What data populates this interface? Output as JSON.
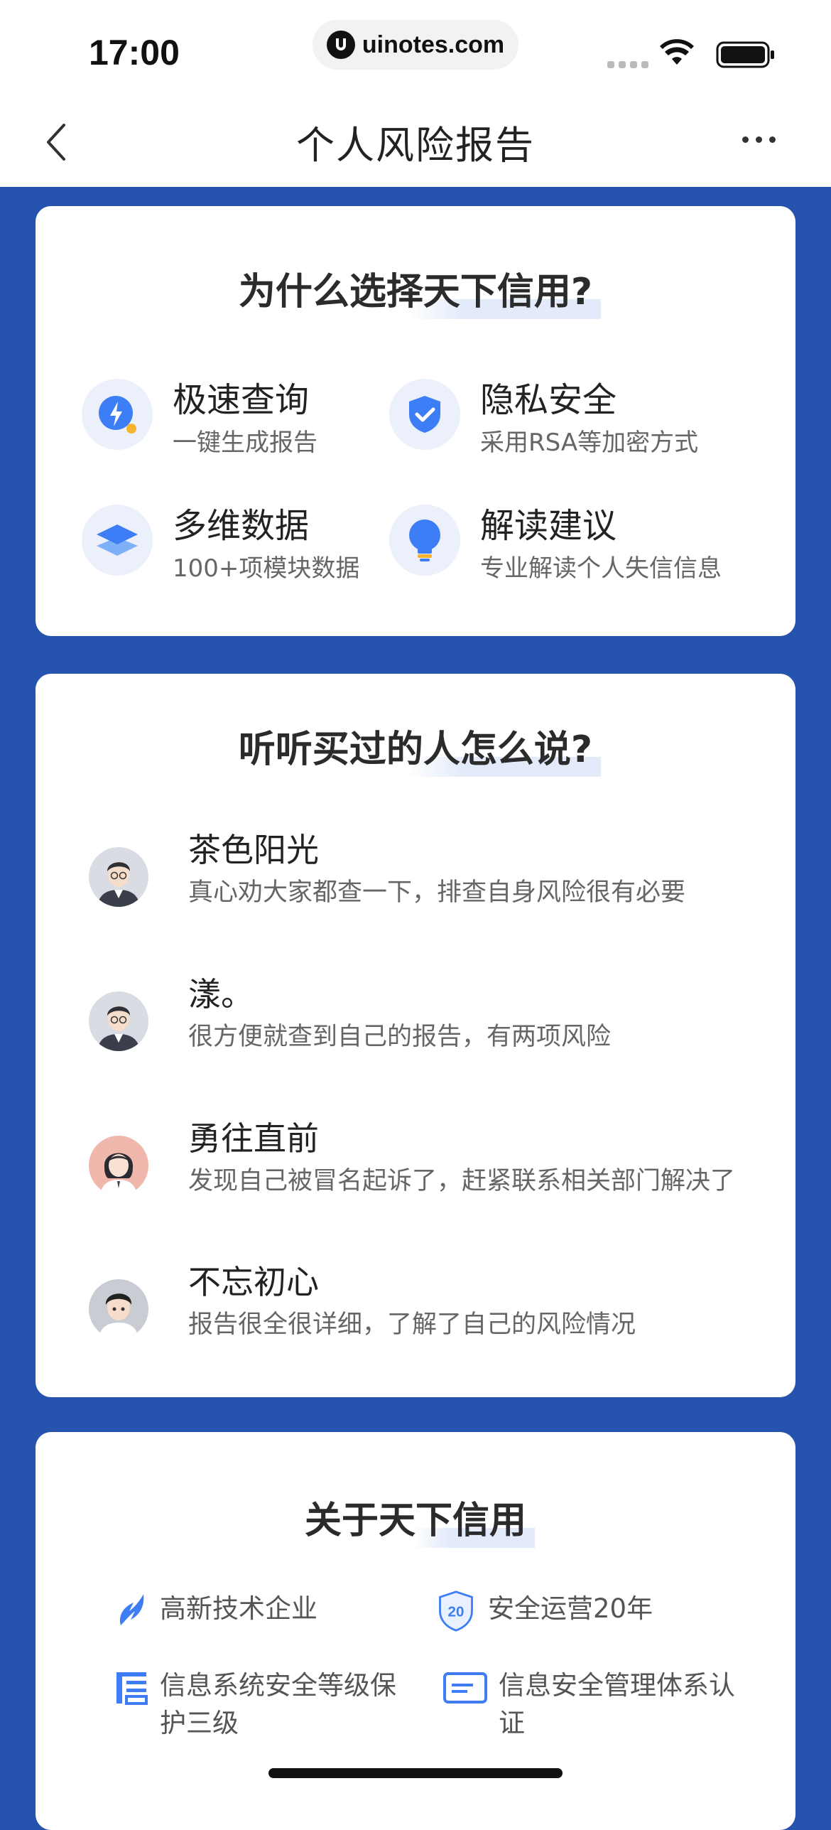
{
  "status": {
    "time": "17:00",
    "url": "uinotes.com"
  },
  "nav": {
    "title": "个人风险报告"
  },
  "why": {
    "title": "为什么选择天下信用?",
    "features": [
      {
        "icon": "lightning-icon",
        "title": "极速查询",
        "subtitle": "一键生成报告"
      },
      {
        "icon": "shield-check-icon",
        "title": "隐私安全",
        "subtitle": "采用RSA等加密方式"
      },
      {
        "icon": "layers-icon",
        "title": "多维数据",
        "subtitle": "100+项模块数据"
      },
      {
        "icon": "lightbulb-icon",
        "title": "解读建议",
        "subtitle": "专业解读个人失信信息"
      }
    ]
  },
  "reviews": {
    "title": "听听买过的人怎么说?",
    "items": [
      {
        "name": "茶色阳光",
        "text": "真心劝大家都查一下，排查自身风险很有必要"
      },
      {
        "name": "漾。",
        "text": "很方便就查到自己的报告，有两项风险"
      },
      {
        "name": "勇往直前",
        "text": "发现自己被冒名起诉了，赶紧联系相关部门解决了"
      },
      {
        "name": "不忘初心",
        "text": "报告很全很详细，了解了自己的风险情况"
      }
    ]
  },
  "about": {
    "title": "关于天下信用",
    "items": [
      {
        "icon": "tech-enterprise-icon",
        "text": "高新技术企业"
      },
      {
        "icon": "badge-20-icon",
        "text": "安全运营20年",
        "badge": "20"
      },
      {
        "icon": "security-level-icon",
        "text": "信息系统安全等级保护三级"
      },
      {
        "icon": "certificate-icon",
        "text": "信息安全管理体系认证"
      }
    ]
  },
  "colors": {
    "primary": "#2553ad",
    "accent": "#3d7df5",
    "icon_bg": "#ebf0fb"
  }
}
